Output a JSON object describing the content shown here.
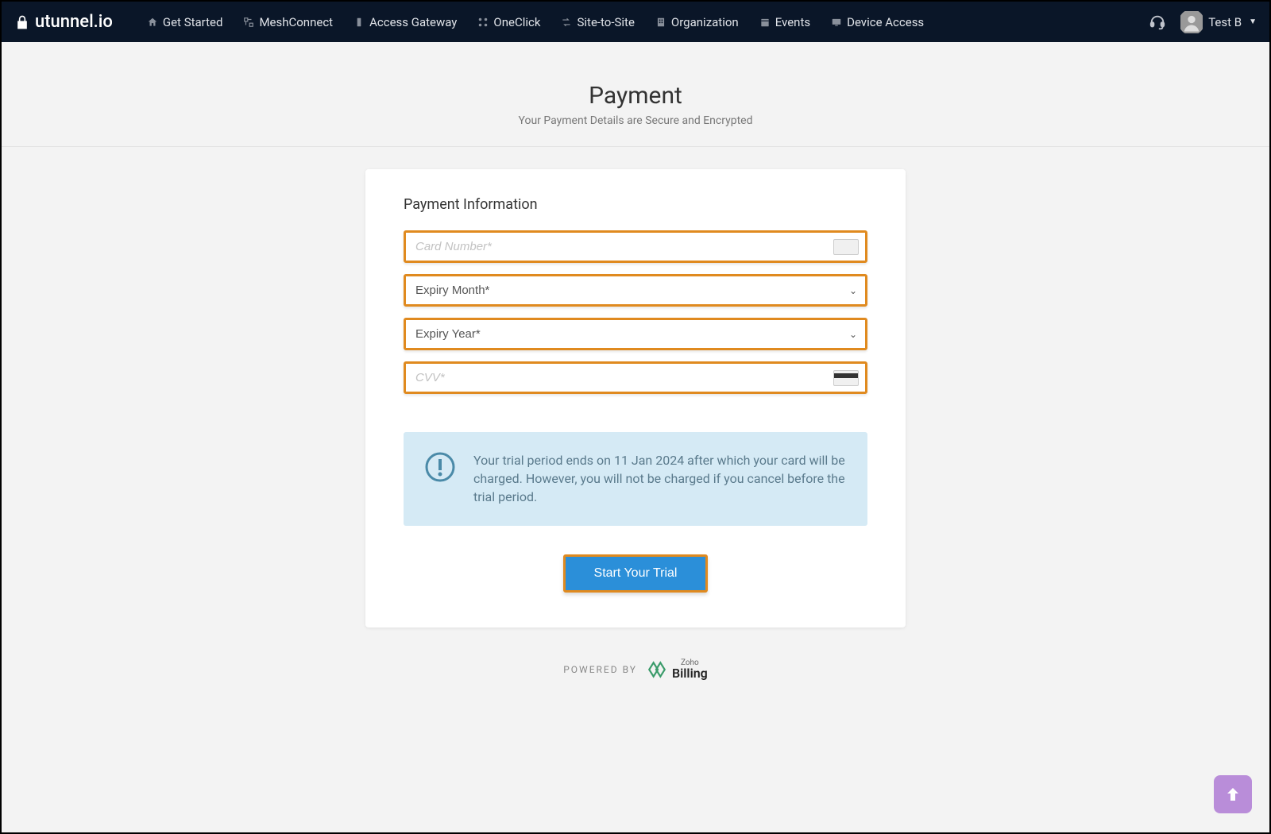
{
  "brand": {
    "name": "utunnel.io"
  },
  "nav": {
    "items": [
      {
        "label": "Get Started",
        "name": "nav-get-started",
        "icon": "home"
      },
      {
        "label": "MeshConnect",
        "name": "nav-meshconnect",
        "icon": "mesh"
      },
      {
        "label": "Access Gateway",
        "name": "nav-access-gateway",
        "icon": "gateway"
      },
      {
        "label": "OneClick",
        "name": "nav-oneclick",
        "icon": "oneclick"
      },
      {
        "label": "Site-to-Site",
        "name": "nav-site-to-site",
        "icon": "sitesite"
      },
      {
        "label": "Organization",
        "name": "nav-organization",
        "icon": "org"
      },
      {
        "label": "Events",
        "name": "nav-events",
        "icon": "events"
      },
      {
        "label": "Device Access",
        "name": "nav-device-access",
        "icon": "device"
      }
    ]
  },
  "user": {
    "name": "Test B"
  },
  "page": {
    "title": "Payment",
    "subtitle": "Your Payment Details are Secure and Encrypted"
  },
  "form": {
    "section_title": "Payment Information",
    "card_number": {
      "placeholder": "Card Number*",
      "value": ""
    },
    "expiry_month": {
      "label": "Expiry Month*"
    },
    "expiry_year": {
      "label": "Expiry Year*"
    },
    "cvv": {
      "placeholder": "CVV*",
      "value": ""
    },
    "submit_label": "Start Your Trial"
  },
  "info": {
    "text": "Your trial period ends on 11 Jan 2024 after which your card will be charged. However, you will not be charged if you cancel before the trial period."
  },
  "footer": {
    "powered_by": "POWERED BY",
    "billing_brand_small": "Zoho",
    "billing_brand": "Billing"
  },
  "colors": {
    "highlight_border": "#e08a1f",
    "primary_button": "#2b8fd9",
    "info_bg": "#d5eaf5",
    "scroll_top": "#b98dd9"
  }
}
